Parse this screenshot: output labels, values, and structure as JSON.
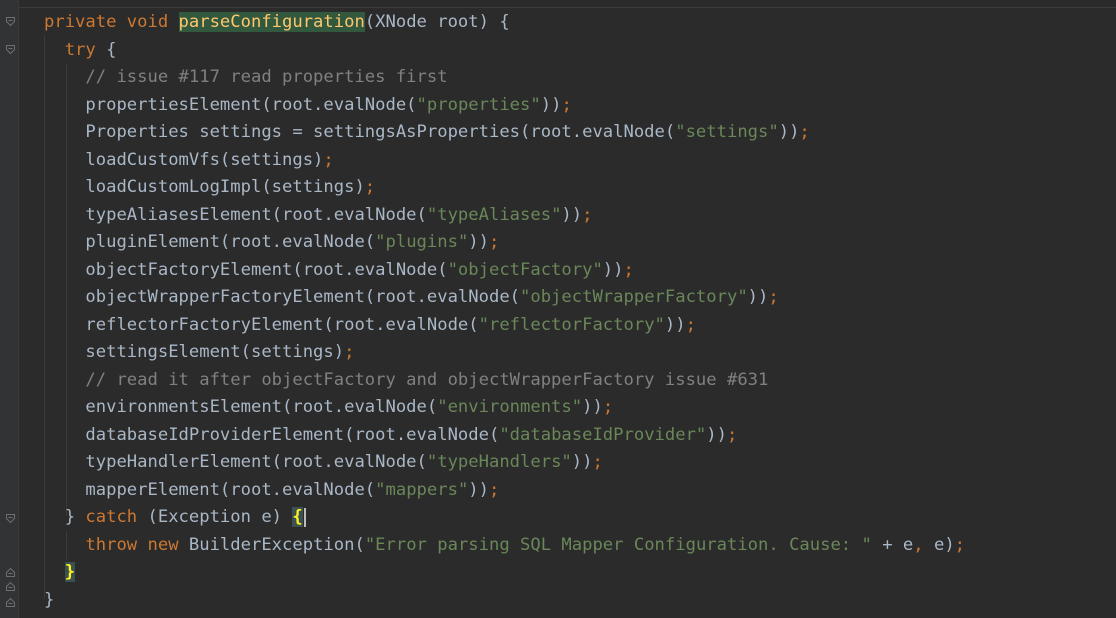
{
  "editor": {
    "background": "#2b2b2b",
    "colors": {
      "keyword": "#cc7832",
      "default": "#a9b7c6",
      "string": "#6a8759",
      "comment": "#808080",
      "method_highlight": "#ffc66d",
      "method_highlight_bg": "#32593d",
      "brace_match": "#ffef28"
    },
    "gutter_icons": [
      "fold-open-icon",
      "fold-open-icon",
      "fold-open-icon",
      "fold-close-icon",
      "fold-close-icon",
      "fold-close-icon"
    ],
    "lines": [
      [
        {
          "t": "kw",
          "v": "private void "
        },
        {
          "t": "fnhl",
          "v": "parseConfiguration"
        },
        {
          "t": "p",
          "v": "(XNode root) {"
        }
      ],
      [
        {
          "t": "ind",
          "v": "  "
        },
        {
          "t": "kw",
          "v": "try "
        },
        {
          "t": "p",
          "v": "{"
        }
      ],
      [
        {
          "t": "ind",
          "v": "    "
        },
        {
          "t": "cmt",
          "v": "// issue #117 read properties first"
        }
      ],
      [
        {
          "t": "ind",
          "v": "    "
        },
        {
          "t": "p",
          "v": "propertiesElement(root.evalNode("
        },
        {
          "t": "str",
          "v": "\"properties\""
        },
        {
          "t": "p",
          "v": "))"
        },
        {
          "t": "kw",
          "v": ";"
        }
      ],
      [
        {
          "t": "ind",
          "v": "    "
        },
        {
          "t": "p",
          "v": "Properties settings = settingsAsProperties(root.evalNode("
        },
        {
          "t": "str",
          "v": "\"settings\""
        },
        {
          "t": "p",
          "v": "))"
        },
        {
          "t": "kw",
          "v": ";"
        }
      ],
      [
        {
          "t": "ind",
          "v": "    "
        },
        {
          "t": "p",
          "v": "loadCustomVfs(settings)"
        },
        {
          "t": "kw",
          "v": ";"
        }
      ],
      [
        {
          "t": "ind",
          "v": "    "
        },
        {
          "t": "p",
          "v": "loadCustomLogImpl(settings)"
        },
        {
          "t": "kw",
          "v": ";"
        }
      ],
      [
        {
          "t": "ind",
          "v": "    "
        },
        {
          "t": "p",
          "v": "typeAliasesElement(root.evalNode("
        },
        {
          "t": "str",
          "v": "\"typeAliases\""
        },
        {
          "t": "p",
          "v": "))"
        },
        {
          "t": "kw",
          "v": ";"
        }
      ],
      [
        {
          "t": "ind",
          "v": "    "
        },
        {
          "t": "p",
          "v": "pluginElement(root.evalNode("
        },
        {
          "t": "str",
          "v": "\"plugins\""
        },
        {
          "t": "p",
          "v": "))"
        },
        {
          "t": "kw",
          "v": ";"
        }
      ],
      [
        {
          "t": "ind",
          "v": "    "
        },
        {
          "t": "p",
          "v": "objectFactoryElement(root.evalNode("
        },
        {
          "t": "str",
          "v": "\"objectFactory\""
        },
        {
          "t": "p",
          "v": "))"
        },
        {
          "t": "kw",
          "v": ";"
        }
      ],
      [
        {
          "t": "ind",
          "v": "    "
        },
        {
          "t": "p",
          "v": "objectWrapperFactoryElement(root.evalNode("
        },
        {
          "t": "str",
          "v": "\"objectWrapperFactory\""
        },
        {
          "t": "p",
          "v": "))"
        },
        {
          "t": "kw",
          "v": ";"
        }
      ],
      [
        {
          "t": "ind",
          "v": "    "
        },
        {
          "t": "p",
          "v": "reflectorFactoryElement(root.evalNode("
        },
        {
          "t": "str",
          "v": "\"reflectorFactory\""
        },
        {
          "t": "p",
          "v": "))"
        },
        {
          "t": "kw",
          "v": ";"
        }
      ],
      [
        {
          "t": "ind",
          "v": "    "
        },
        {
          "t": "p",
          "v": "settingsElement(settings)"
        },
        {
          "t": "kw",
          "v": ";"
        }
      ],
      [
        {
          "t": "ind",
          "v": "    "
        },
        {
          "t": "cmt",
          "v": "// read it after objectFactory and objectWrapperFactory issue #631"
        }
      ],
      [
        {
          "t": "ind",
          "v": "    "
        },
        {
          "t": "p",
          "v": "environmentsElement(root.evalNode("
        },
        {
          "t": "str",
          "v": "\"environments\""
        },
        {
          "t": "p",
          "v": "))"
        },
        {
          "t": "kw",
          "v": ";"
        }
      ],
      [
        {
          "t": "ind",
          "v": "    "
        },
        {
          "t": "p",
          "v": "databaseIdProviderElement(root.evalNode("
        },
        {
          "t": "str",
          "v": "\"databaseIdProvider\""
        },
        {
          "t": "p",
          "v": "))"
        },
        {
          "t": "kw",
          "v": ";"
        }
      ],
      [
        {
          "t": "ind",
          "v": "    "
        },
        {
          "t": "p",
          "v": "typeHandlerElement(root.evalNode("
        },
        {
          "t": "str",
          "v": "\"typeHandlers\""
        },
        {
          "t": "p",
          "v": "))"
        },
        {
          "t": "kw",
          "v": ";"
        }
      ],
      [
        {
          "t": "ind",
          "v": "    "
        },
        {
          "t": "p",
          "v": "mapperElement(root.evalNode("
        },
        {
          "t": "str",
          "v": "\"mappers\""
        },
        {
          "t": "p",
          "v": "))"
        },
        {
          "t": "kw",
          "v": ";"
        }
      ],
      [
        {
          "t": "ind",
          "v": "  "
        },
        {
          "t": "p",
          "v": "} "
        },
        {
          "t": "kw",
          "v": "catch "
        },
        {
          "t": "p",
          "v": "(Exception e) "
        },
        {
          "t": "bm",
          "v": "{"
        },
        {
          "t": "caret",
          "v": ""
        }
      ],
      [
        {
          "t": "ind",
          "v": "    "
        },
        {
          "t": "kw",
          "v": "throw new "
        },
        {
          "t": "p",
          "v": "BuilderException("
        },
        {
          "t": "str",
          "v": "\"Error parsing SQL Mapper Configuration. Cause: \""
        },
        {
          "t": "p",
          "v": " + e"
        },
        {
          "t": "kw",
          "v": ", "
        },
        {
          "t": "p",
          "v": "e)"
        },
        {
          "t": "kw",
          "v": ";"
        }
      ],
      [
        {
          "t": "ind",
          "v": "  "
        },
        {
          "t": "bm",
          "v": "}"
        }
      ],
      [
        {
          "t": "p",
          "v": "}"
        }
      ]
    ]
  }
}
